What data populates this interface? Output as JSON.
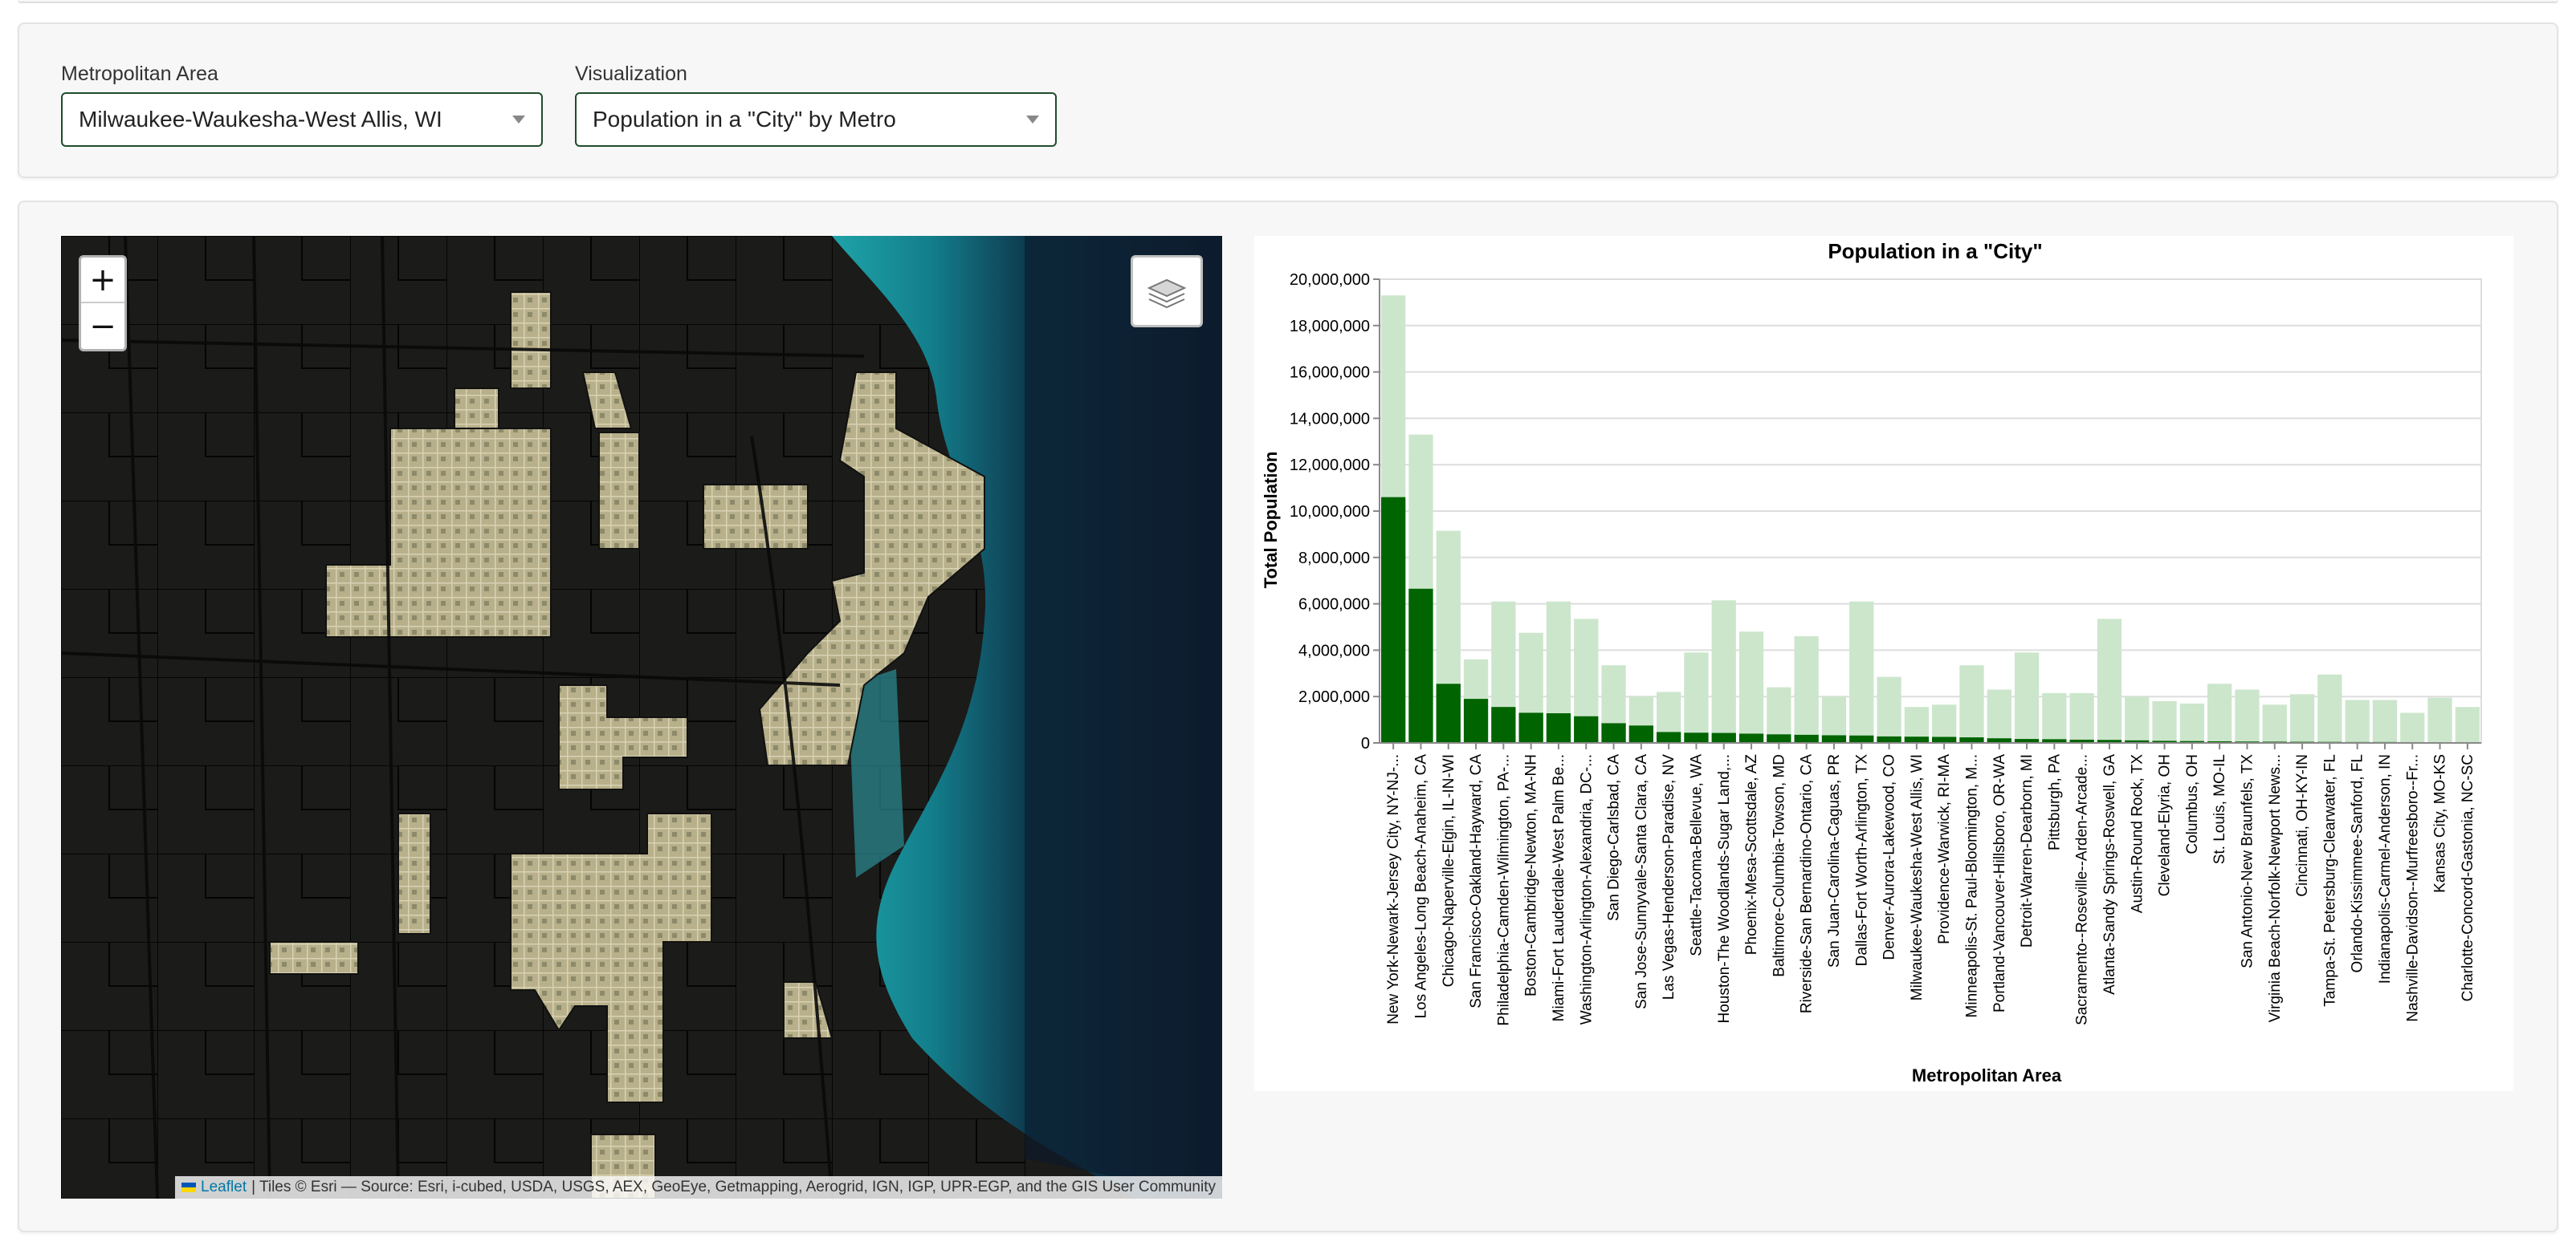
{
  "controls": {
    "metro_label": "Metropolitan Area",
    "metro_value": "Milwaukee-Waukesha-West Allis, WI",
    "viz_label": "Visualization",
    "viz_value": "Population in a \"City\" by Metro"
  },
  "map": {
    "zoom_in": "+",
    "zoom_out": "−",
    "attribution_link": "Leaflet",
    "attribution_text": "| Tiles © Esri — Source: Esri, i-cubed, USDA, USGS, AEX, GeoEye, Getmapping, Aerogrid, IGN, IGP, UPR-EGP, and the GIS User Community"
  },
  "colors": {
    "city": "#006400",
    "total": "#cce6cc",
    "accent": "#1f4d2b"
  },
  "chart_data": {
    "type": "bar",
    "title": "Population in a \"City\"",
    "xlabel": "Metropolitan Area",
    "ylabel": "Total Population",
    "ylim": [
      0,
      20000000
    ],
    "yticks": [
      "0",
      "2,000,000",
      "4,000,000",
      "6,000,000",
      "8,000,000",
      "10,000,000",
      "12,000,000",
      "14,000,000",
      "16,000,000",
      "18,000,000",
      "20,000,000"
    ],
    "grid": true,
    "categories": [
      "New York-Newark-Jersey City, NY-NJ-...",
      "Los Angeles-Long Beach-Anaheim, CA",
      "Chicago-Naperville-Elgin, IL-IN-WI",
      "San Francisco-Oakland-Hayward, CA",
      "Philadelphia-Camden-Wilmington, PA-...",
      "Boston-Cambridge-Newton, MA-NH",
      "Miami-Fort Lauderdale-West Palm Be...",
      "Washington-Arlington-Alexandria, DC-...",
      "San Diego-Carlsbad, CA",
      "San Jose-Sunnyvale-Santa Clara, CA",
      "Las Vegas-Henderson-Paradise, NV",
      "Seattle-Tacoma-Bellevue, WA",
      "Houston-The Woodlands-Sugar Land,...",
      "Phoenix-Mesa-Scottsdale, AZ",
      "Baltimore-Columbia-Towson, MD",
      "Riverside-San Bernardino-Ontario, CA",
      "San Juan-Carolina-Caguas, PR",
      "Dallas-Fort Worth-Arlington, TX",
      "Denver-Aurora-Lakewood, CO",
      "Milwaukee-Waukesha-West Allis, WI",
      "Providence-Warwick, RI-MA",
      "Minneapolis-St. Paul-Bloomington, M...",
      "Portland-Vancouver-Hillsboro, OR-WA",
      "Detroit-Warren-Dearborn, MI",
      "Pittsburgh, PA",
      "Sacramento--Roseville--Arden-Arcade...",
      "Atlanta-Sandy Springs-Roswell, GA",
      "Austin-Round Rock, TX",
      "Cleveland-Elyria, OH",
      "Columbus, OH",
      "St. Louis, MO-IL",
      "San Antonio-New Braunfels, TX",
      "Virginia Beach-Norfolk-Newport News...",
      "Cincinnati, OH-KY-IN",
      "Tampa-St. Petersburg-Clearwater, FL",
      "Orlando-Kissimmee-Sanford, FL",
      "Indianapolis-Carmel-Anderson, IN",
      "Nashville-Davidson--Murfreesboro--Fr...",
      "Kansas City, MO-KS",
      "Charlotte-Concord-Gastonia, NC-SC"
    ],
    "series": [
      {
        "values": [
          19300000,
          13300000,
          9150000,
          3600000,
          6100000,
          4750000,
          6100000,
          5350000,
          3350000,
          2000000,
          2200000,
          3900000,
          6150000,
          4800000,
          2400000,
          4600000,
          2000000,
          6100000,
          2850000,
          1550000,
          1650000,
          3350000,
          2300000,
          3900000,
          2150000,
          2150000,
          5350000,
          2000000,
          1800000,
          1700000,
          2550000,
          2300000,
          1650000,
          2100000,
          2950000,
          1850000,
          1850000,
          1300000,
          1950000,
          1550000
        ]
      },
      {
        "values": [
          10600000,
          6650000,
          2550000,
          1900000,
          1550000,
          1300000,
          1280000,
          1150000,
          850000,
          750000,
          470000,
          440000,
          430000,
          400000,
          370000,
          350000,
          330000,
          320000,
          280000,
          270000,
          260000,
          240000,
          200000,
          170000,
          160000,
          140000,
          130000,
          110000,
          90000,
          80000,
          70000,
          60000,
          55000,
          50000,
          45000,
          40000,
          40000,
          35000,
          30000,
          25000
        ]
      }
    ]
  }
}
